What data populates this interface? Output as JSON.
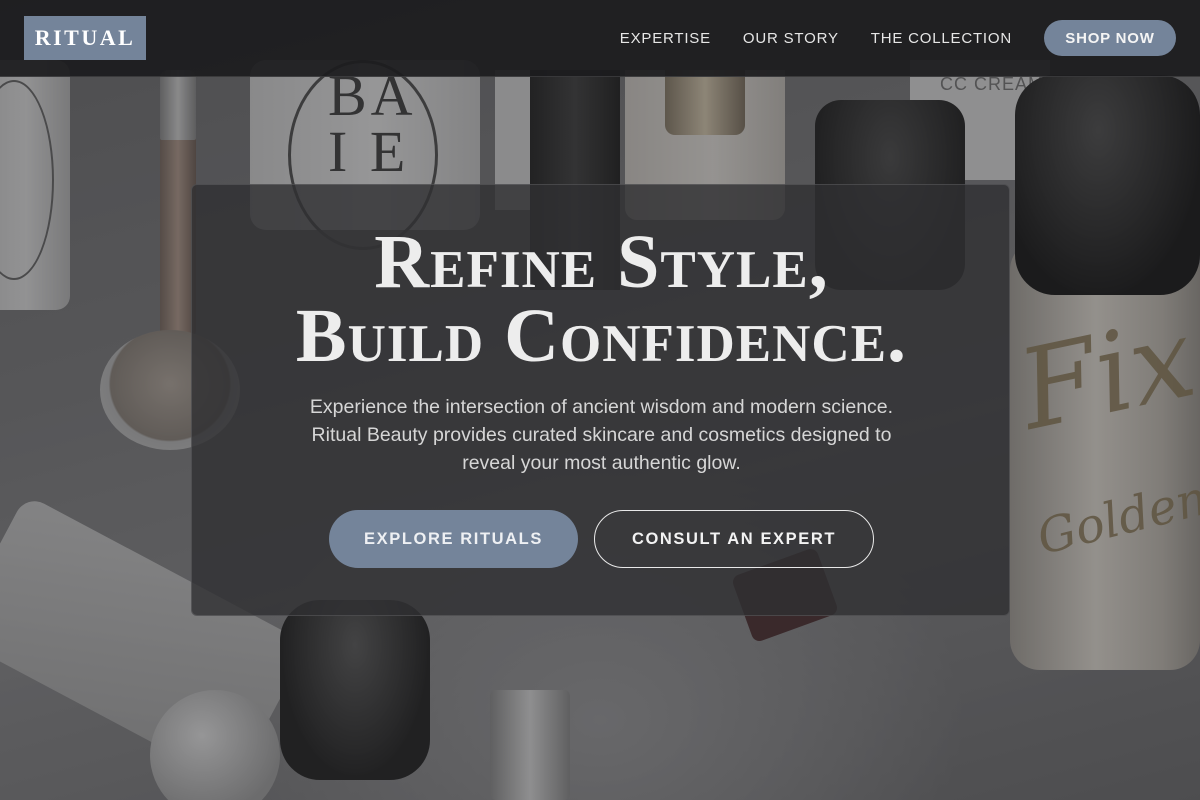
{
  "brand": {
    "logo_text": "RITUAL",
    "accent_color": "#74849a"
  },
  "nav": {
    "links": [
      "EXPERTISE",
      "OUR STORY",
      "THE COLLECTION"
    ],
    "cta_label": "SHOP NOW"
  },
  "hero": {
    "headline_lines": [
      "Refine Style,",
      "Build Confidence."
    ],
    "subtext_lines": [
      "Experience the intersection of ancient wisdom and modern science.",
      "Ritual Beauty provides curated skincare and cosmetics designed to",
      "reveal your most authentic glow."
    ],
    "primary_button": "EXPLORE RITUALS",
    "secondary_button": "CONSULT AN EXPERT",
    "background_image": "cosmetics-product-photo"
  }
}
